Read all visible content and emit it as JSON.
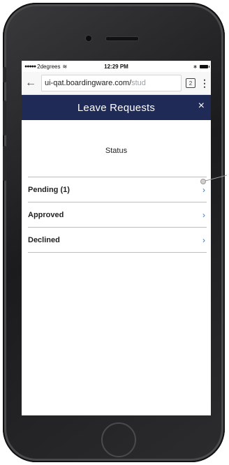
{
  "status_bar": {
    "signal": "●●●●●",
    "carrier": "2degrees",
    "wifi": "≋",
    "time": "12:29 PM",
    "bluetooth": "∗"
  },
  "browser": {
    "back": "←",
    "url_host": "ui-qat.boardingware.com/",
    "url_path": "stud",
    "tab_count": "2",
    "menu": "⋮"
  },
  "header": {
    "title": "Leave Requests",
    "close": "×",
    "background": "#1f2a57"
  },
  "content": {
    "heading": "Status",
    "items": [
      {
        "label": "Pending (1)",
        "chevron": "›"
      },
      {
        "label": "Approved",
        "chevron": "›"
      },
      {
        "label": "Declined",
        "chevron": "›"
      }
    ]
  },
  "colors": {
    "accent": "#2a7ad5",
    "divider": "#bdbdbd"
  }
}
